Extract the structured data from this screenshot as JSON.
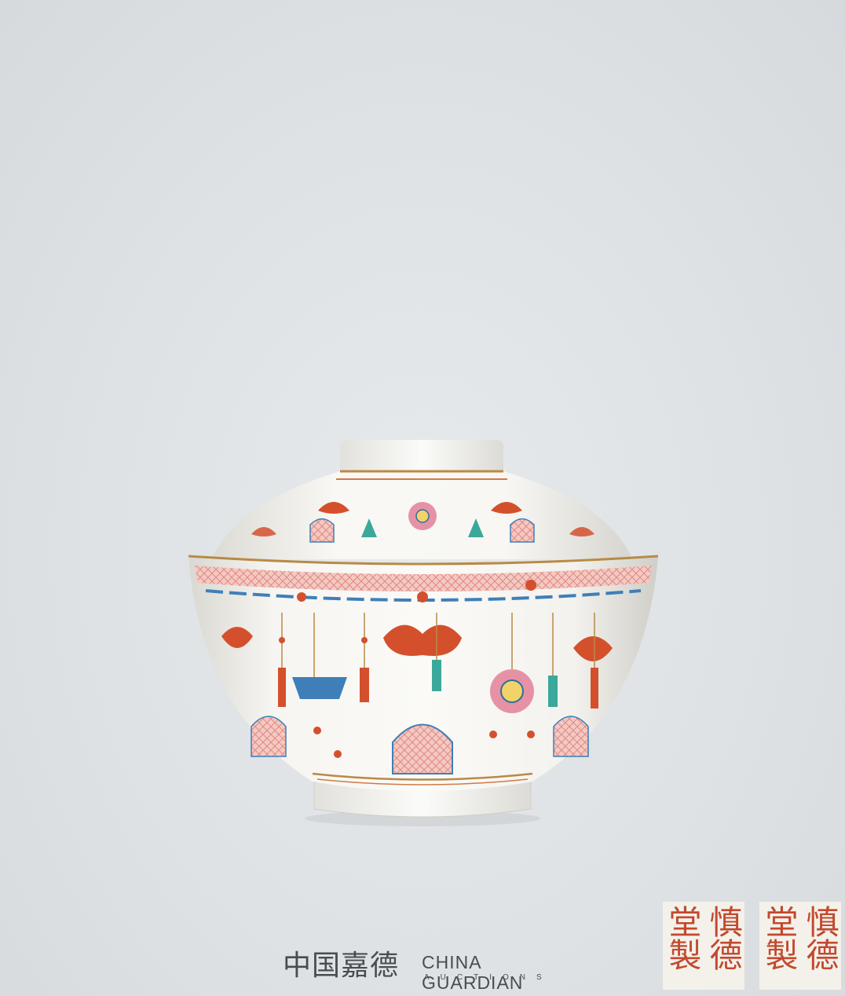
{
  "logo": {
    "chinese_name": "中国嘉德",
    "english_name": "CHINA GUARDIAN",
    "english_sub": "AUCTIONS"
  },
  "reign_marks": [
    {
      "right_column": "慎德",
      "left_column": "堂製"
    },
    {
      "right_column": "慎德",
      "left_column": "堂製"
    }
  ],
  "colors": {
    "background": "#dfe3e6",
    "porcelain_white": "#f8f7f3",
    "iron_red": "#d4502d",
    "rose_pink": "#e592a6",
    "turquoise": "#3aa89a",
    "blue_enamel": "#3f7fb8",
    "gilt": "#b98a45",
    "logo_text": "#4a4d4f",
    "mark_red": "#c2492e"
  }
}
